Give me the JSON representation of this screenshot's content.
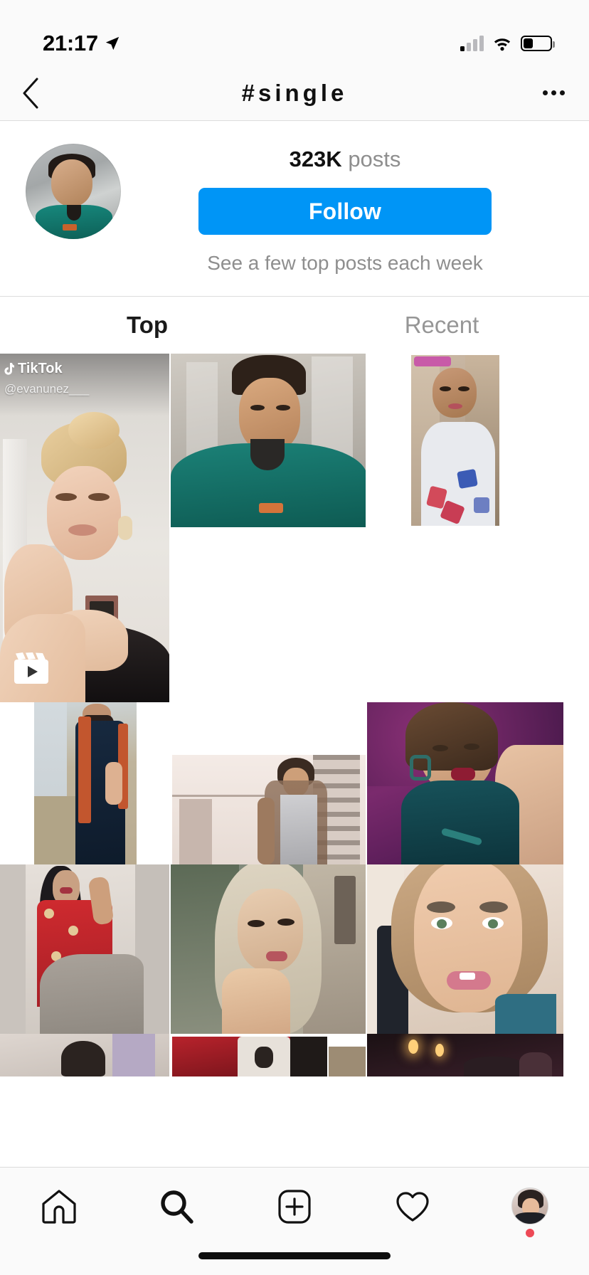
{
  "status_bar": {
    "time": "21:17",
    "location_icon": "location-arrow-icon",
    "signal_icon": "cellular-signal-icon",
    "signal_bars": 1,
    "wifi_icon": "wifi-icon",
    "battery_icon": "battery-icon",
    "battery_level_percent": 35
  },
  "nav_bar": {
    "back_icon": "chevron-left-icon",
    "title": "#single",
    "more_icon": "more-options-icon"
  },
  "hashtag_header": {
    "avatar_name": "hashtag-avatar",
    "posts_count": "323K",
    "posts_label": "posts",
    "follow_label": "Follow",
    "subtitle": "See a few top posts each week",
    "follow_color": "#0095f6"
  },
  "tabs": [
    {
      "label": "Top",
      "active": true
    },
    {
      "label": "Recent",
      "active": false
    }
  ],
  "grid": {
    "watermark": {
      "brand": "TikTok",
      "handle": "@evanunez___"
    },
    "rows": [
      {
        "name": "grid-row-1",
        "cells": [
          {
            "name": "post-tall-makeup",
            "badge": "reel-icon",
            "watermark": true
          },
          {
            "name": "post-man-teal-sweater"
          },
          {
            "name": "post-girl-earphones"
          }
        ]
      },
      {
        "name": "grid-row-2",
        "cells": [
          {
            "name": "post-woman-beanie-field"
          },
          {
            "name": "post-girl-beach-phone"
          }
        ]
      },
      {
        "name": "grid-row-3",
        "cells": [
          {
            "name": "post-woman-saree"
          },
          {
            "name": "post-girl-stairs"
          },
          {
            "name": "post-woman-purple-couch"
          }
        ]
      },
      {
        "name": "grid-row-4",
        "cells": [
          {
            "name": "post-woman-red-dress"
          },
          {
            "name": "post-girl-hijab"
          },
          {
            "name": "post-woman-blonde-selfie"
          }
        ]
      },
      {
        "name": "grid-row-5-partial",
        "cells": [
          {
            "name": "post-partial-left"
          },
          {
            "name": "post-partial-middle"
          },
          {
            "name": "post-partial-right"
          }
        ]
      }
    ]
  },
  "bottom_nav": {
    "items": [
      {
        "name": "home-icon",
        "label": "Home",
        "active": false
      },
      {
        "name": "search-icon",
        "label": "Search",
        "active": true
      },
      {
        "name": "add-post-icon",
        "label": "New Post",
        "active": false
      },
      {
        "name": "activity-heart-icon",
        "label": "Activity",
        "active": false
      },
      {
        "name": "profile-avatar",
        "label": "Profile",
        "active": false,
        "has_notification_dot": true
      }
    ]
  },
  "home_indicator": "home-indicator"
}
